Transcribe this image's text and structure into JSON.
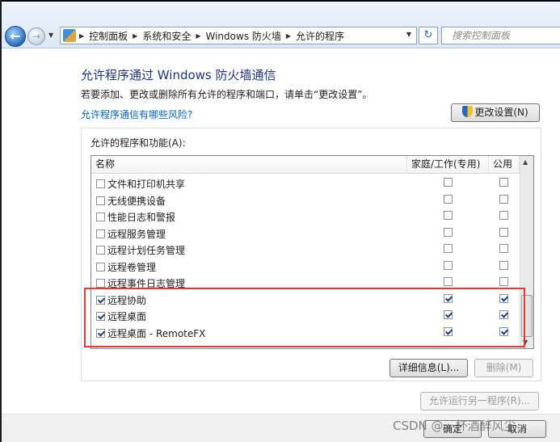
{
  "address_bar": {
    "breadcrumbs": [
      "控制面板",
      "系统和安全",
      "Windows 防火墙",
      "允许的程序"
    ],
    "search_placeholder": "搜索控制面板"
  },
  "header": {
    "title": "允许程序通过 Windows 防火墙通信",
    "description": "若要添加、更改或删除所有允许的程序和端口，请单击“更改设置”。",
    "risk_link": "允许程序通信有哪些风险?",
    "change_settings_label": "更改设置(N)"
  },
  "programs": {
    "group_label": "允许的程序和功能(A):",
    "columns": {
      "name": "名称",
      "home": "家庭/工作(专用)",
      "public": "公用"
    },
    "rows": [
      {
        "name": "文件和打印机共享",
        "enabled": false,
        "home": false,
        "public": false
      },
      {
        "name": "无线便携设备",
        "enabled": false,
        "home": false,
        "public": false
      },
      {
        "name": "性能日志和警报",
        "enabled": false,
        "home": false,
        "public": false
      },
      {
        "name": "远程服务管理",
        "enabled": false,
        "home": false,
        "public": false
      },
      {
        "name": "远程计划任务管理",
        "enabled": false,
        "home": false,
        "public": false
      },
      {
        "name": "远程卷管理",
        "enabled": false,
        "home": false,
        "public": false
      },
      {
        "name": "远程事件日志管理",
        "enabled": false,
        "home": false,
        "public": false
      },
      {
        "name": "远程协助",
        "enabled": true,
        "home": true,
        "public": true
      },
      {
        "name": "远程桌面",
        "enabled": true,
        "home": true,
        "public": true
      },
      {
        "name": "远程桌面 - RemoteFX",
        "enabled": true,
        "home": true,
        "public": true
      }
    ],
    "details_label": "详细信息(L)...",
    "remove_label": "删除(M)"
  },
  "allow_another_label": "允许运行另一程序(R)...",
  "footer": {
    "ok_label": "确定",
    "cancel_label": "取消"
  },
  "watermark": "CSDN @一杯酒醉风尘",
  "colors": {
    "title": "#1e3287",
    "link": "#0066cc",
    "highlight": "#e53935"
  }
}
